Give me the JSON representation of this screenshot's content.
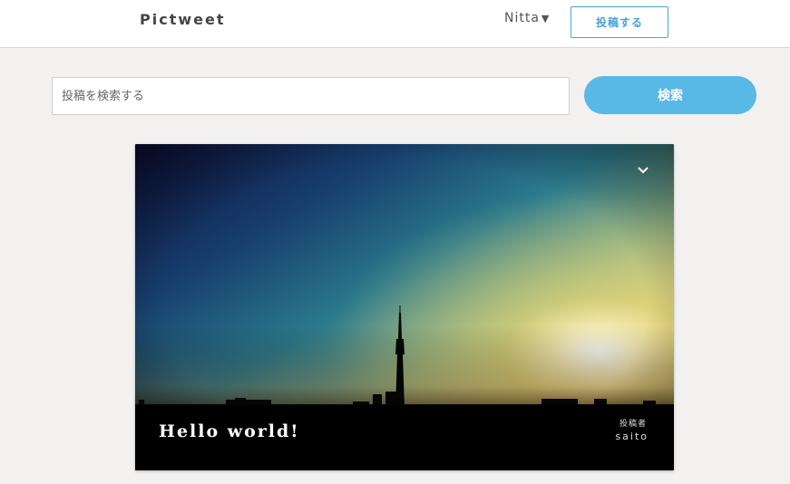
{
  "header": {
    "logo": "Pictweet",
    "user_name": "Nitta",
    "user_caret": "▼",
    "post_button": "投稿する"
  },
  "search": {
    "placeholder": "投稿を検索する",
    "button_label": "検索"
  },
  "tweets": [
    {
      "title": "Hello world!",
      "author_label": "投稿者",
      "author_name": "saito",
      "menu_icon": "chevron-down-icon"
    }
  ],
  "colors": {
    "accent": "#58b8e6",
    "header_bg": "#ffffff",
    "page_bg": "#f2f1ef"
  }
}
